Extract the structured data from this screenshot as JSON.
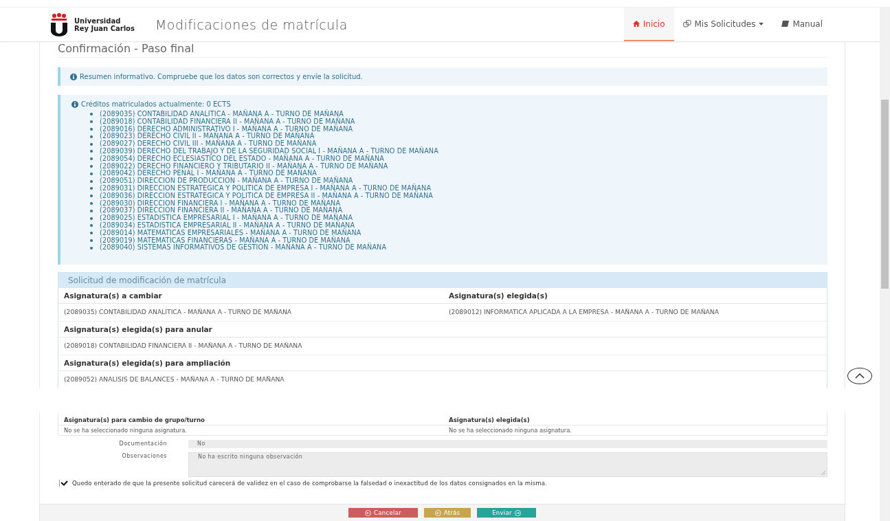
{
  "header": {
    "university_line1": "Universidad",
    "university_line2": "Rey Juan Carlos",
    "app_title": "Modificaciones de matrícula",
    "nav": [
      {
        "label": "Inicio",
        "selected": true,
        "kind": "home"
      },
      {
        "label": "Mis Solicitudes",
        "selected": false,
        "kind": "dropdown"
      },
      {
        "label": "Manual",
        "selected": false,
        "kind": "book"
      }
    ]
  },
  "page_title": "Confirmación - Paso final",
  "info_alert": "Resumen informativo. Compruebe que los datos son correctos y envíe la solicitud.",
  "credits": {
    "heading": "Créditos matriculados actualmente: 0 ECTS",
    "items": [
      "(2089035) CONTABILIDAD ANALITICA - MAÑANA A - TURNO DE MAÑANA",
      "(2089018) CONTABILIDAD FINANCIERA II - MAÑANA A - TURNO DE MAÑANA",
      "(2089016) DERECHO ADMINISTRATIVO I - MAÑANA A - TURNO DE MAÑANA",
      "(2089023) DERECHO CIVIL II - MAÑANA A - TURNO DE MAÑANA",
      "(2089027) DERECHO CIVIL III - MAÑANA A - TURNO DE MAÑANA",
      "(2089039) DERECHO DEL TRABAJO Y DE LA SEGURIDAD SOCIAL I - MAÑANA A - TURNO DE MAÑANA",
      "(2089054) DERECHO ECLESIASTICO DEL ESTADO - MAÑANA A - TURNO DE MAÑANA",
      "(2089022) DERECHO FINANCIERO Y TRIBUTARIO II - MAÑANA A - TURNO DE MAÑANA",
      "(2089042) DERECHO PENAL I - MAÑANA A - TURNO DE MAÑANA",
      "(2089051) DIRECCION DE PRODUCCION - MAÑANA A - TURNO DE MAÑANA",
      "(2089031) DIRECCION ESTRATEGICA Y POLITICA DE EMPRESA I - MAÑANA A - TURNO DE MAÑANA",
      "(2089036) DIRECCION ESTRATEGICA Y POLITICA DE EMPRESA II - MAÑANA A - TURNO DE MAÑANA",
      "(2089030) DIRECCION FINANCIERA I - MAÑANA A - TURNO DE MAÑANA",
      "(2089037) DIRECCION FINANCIERA II - MAÑANA A - TURNO DE MAÑANA",
      "(2089025) ESTADISTICA EMPRESARIAL I - MAÑANA A - TURNO DE MAÑANA",
      "(2089034) ESTADISTICA EMPRESARIAL II - MAÑANA A - TURNO DE MAÑANA",
      "(2089014) MATEMATICAS EMPRESARIALES - MAÑANA A - TURNO DE MAÑANA",
      "(2089019) MATEMATICAS FINANCIERAS - MAÑANA A - TURNO DE MAÑANA",
      "(2089040) SISTEMAS INFORMATIVOS DE GESTION - MAÑANA A - TURNO DE MAÑANA"
    ]
  },
  "request_panel": {
    "title": "Solicitud de modificación de matrícula",
    "sections": [
      {
        "headings": [
          "Asignatura(s) a cambiar",
          "Asignatura(s) elegida(s)"
        ],
        "values": [
          "(2089035) CONTABILIDAD ANALITICA - MAÑANA A - TURNO DE MAÑANA",
          "(2089012) INFORMATICA APLICADA A LA EMPRESA - MAÑANA A - TURNO DE MAÑANA"
        ]
      },
      {
        "headings": [
          "Asignatura(s) elegida(s) para anular"
        ],
        "values": [
          "(2089018) CONTABILIDAD FINANCIERA II - MAÑANA A - TURNO DE MAÑANA"
        ]
      },
      {
        "headings": [
          "Asignatura(s) elegida(s) para ampliación"
        ],
        "values": [
          "(2089052) ANALISIS DE BALANCES - MAÑANA A - TURNO DE MAÑANA"
        ]
      }
    ]
  },
  "lower_section": {
    "headings": [
      "Asignatura(s) para cambio de grupo/turno",
      "Asignatura(s) elegida(s)"
    ],
    "values": [
      "No se ha seleccionado ninguna asignatura.",
      "No se ha seleccionado ninguna asignatura."
    ]
  },
  "fields": [
    {
      "label": "Documentación",
      "value": "No",
      "kind": "input"
    },
    {
      "label": "Observaciones",
      "value": "No ha escrito ninguna observación",
      "kind": "textarea"
    }
  ],
  "agreement": {
    "checked": true,
    "label": "Quedo enterado de que la presente solicitud carecerá de validez en el caso de comprobarse la falsedad o inexactitud de los datos consignados en la misma."
  },
  "buttons": [
    {
      "label": "Cancelar",
      "kind": "cancel"
    },
    {
      "label": "Atrás",
      "kind": "back"
    },
    {
      "label": "Enviar",
      "kind": "send"
    }
  ]
}
